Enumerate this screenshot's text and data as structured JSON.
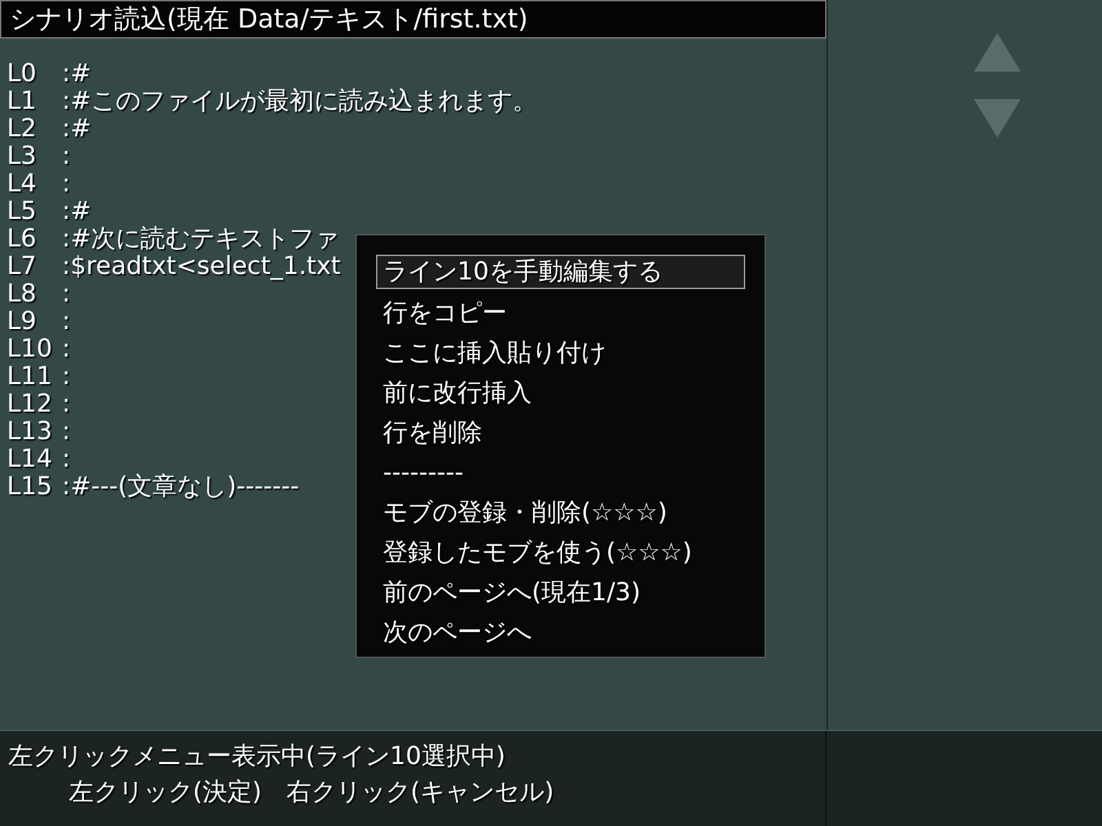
{
  "title": "シナリオ読込(現在 Data/テキスト/first.txt)",
  "lines": [
    {
      "label": "L0",
      "text": ":#"
    },
    {
      "label": "L1",
      "text": ":#このファイルが最初に読み込まれます。"
    },
    {
      "label": "L2",
      "text": ":#"
    },
    {
      "label": "L3",
      "text": ":"
    },
    {
      "label": "L4",
      "text": ":"
    },
    {
      "label": "L5",
      "text": ":#"
    },
    {
      "label": "L6",
      "text": ":#次に読むテキストファ"
    },
    {
      "label": "L7",
      "text": ":$readtxt<select_1.txt"
    },
    {
      "label": "L8",
      "text": ":"
    },
    {
      "label": "L9",
      "text": ":"
    },
    {
      "label": "L10",
      "text": ":"
    },
    {
      "label": "L11",
      "text": ":"
    },
    {
      "label": "L12",
      "text": ":"
    },
    {
      "label": "L13",
      "text": ":"
    },
    {
      "label": "L14",
      "text": ":"
    },
    {
      "label": "L15",
      "text": ":#---(文章なし)-------"
    }
  ],
  "menu": [
    {
      "label": "ライン10を手動編集する",
      "selected": true
    },
    {
      "label": "行をコピー",
      "selected": false
    },
    {
      "label": "ここに挿入貼り付け",
      "selected": false
    },
    {
      "label": "前に改行挿入",
      "selected": false
    },
    {
      "label": "行を削除",
      "selected": false
    },
    {
      "label": "---------",
      "selected": false
    },
    {
      "label": "モブの登録・削除(☆☆☆)",
      "selected": false
    },
    {
      "label": "登録したモブを使う(☆☆☆)",
      "selected": false
    },
    {
      "label": "前のページへ(現在1/3)",
      "selected": false
    },
    {
      "label": "次のページへ",
      "selected": false
    }
  ],
  "status": [
    "左クリックメニュー表示中(ライン10選択中)",
    "左クリック(決定)　右クリック(キャンセル)"
  ]
}
